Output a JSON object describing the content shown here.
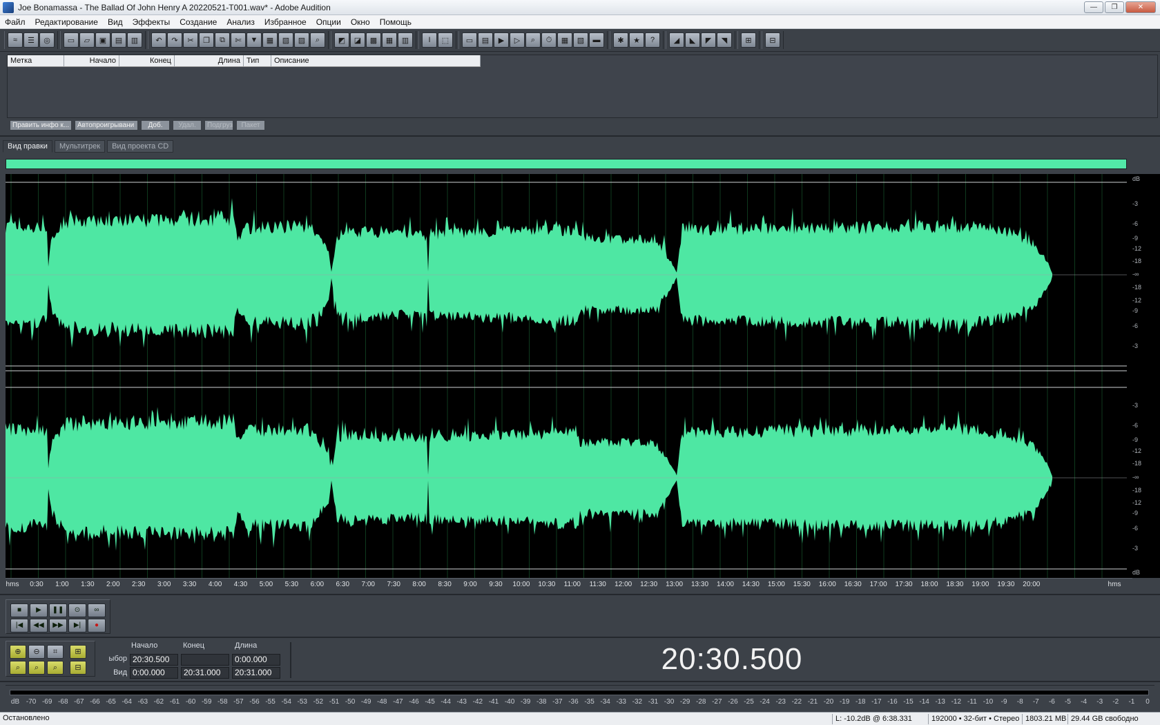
{
  "window": {
    "title": "Joe Bonamassa - The Ballad Of John Henry  A 20220521-T001.wav* - Adobe Audition",
    "buttons": [
      "—",
      "❐",
      "✕"
    ]
  },
  "menu": [
    "Файл",
    "Редактирование",
    "Вид",
    "Эффекты",
    "Создание",
    "Анализ",
    "Избранное",
    "Опции",
    "Окно",
    "Помощь"
  ],
  "cue_list": {
    "columns": [
      "Метка",
      "Начало",
      "Конец",
      "Длина",
      "Тип",
      "Описание"
    ],
    "buttons": [
      {
        "label": "Править инфо к...",
        "enabled": true
      },
      {
        "label": "Автопроигрывани",
        "enabled": true
      },
      {
        "label": "Доб.",
        "enabled": true
      },
      {
        "label": "Удал.",
        "enabled": false
      },
      {
        "label": "Подгруз.",
        "enabled": false
      },
      {
        "label": "Пакет",
        "enabled": false
      }
    ]
  },
  "tabs": [
    {
      "label": "Вид правки",
      "active": true
    },
    {
      "label": "Мультитрек",
      "active": false
    },
    {
      "label": "Вид проекта CD",
      "active": false
    }
  ],
  "waveform": {
    "color": "#4ee7a3",
    "background": "#000000",
    "channels": 2,
    "duration_label": "20:31.000"
  },
  "db_scale": {
    "unit": "dB",
    "top_channel": [
      "dB",
      "-3",
      "-6",
      "-9",
      "-12",
      "-18",
      "-∞",
      "-18",
      "-12",
      "-9",
      "-6",
      "-3"
    ],
    "bottom_channel": [
      "-3",
      "-6",
      "-9",
      "-12",
      "-18",
      "-∞",
      "-18",
      "-12",
      "-9",
      "-6",
      "-3",
      "dB"
    ]
  },
  "timeline": {
    "unit_left": "hms",
    "unit_right": "hms",
    "ticks": [
      "0:30",
      "1:00",
      "1:30",
      "2:00",
      "2:30",
      "3:00",
      "3:30",
      "4:00",
      "4:30",
      "5:00",
      "5:30",
      "6:00",
      "6:30",
      "7:00",
      "7:30",
      "8:00",
      "8:30",
      "9:00",
      "9:30",
      "10:00",
      "10:30",
      "11:00",
      "11:30",
      "12:00",
      "12:30",
      "13:00",
      "13:30",
      "14:00",
      "14:30",
      "15:00",
      "15:30",
      "16:00",
      "16:30",
      "17:00",
      "17:30",
      "18:00",
      "18:30",
      "19:00",
      "19:30",
      "20:00"
    ]
  },
  "transport": {
    "row1": [
      "stop-icon",
      "play-icon",
      "pause-icon",
      "play-to-end-icon",
      "loop-icon"
    ],
    "row2": [
      "go-to-start-icon",
      "rewind-icon",
      "fast-forward-icon",
      "go-to-end-icon",
      "record-icon"
    ]
  },
  "selection": {
    "headers": [
      "Начало",
      "Конец",
      "Длина"
    ],
    "rows": [
      {
        "label": "ыбор",
        "start": "20:30.500",
        "end": "",
        "length": "0:00.000"
      },
      {
        "label": "Вид",
        "start": "0:00.000",
        "end": "20:31.000",
        "length": "20:31.000"
      }
    ]
  },
  "current_time": "20:30.500",
  "level_meter": {
    "ticks": [
      "dB",
      "-70",
      "-69",
      "-68",
      "-67",
      "-66",
      "-65",
      "-64",
      "-63",
      "-62",
      "-61",
      "-60",
      "-59",
      "-58",
      "-57",
      "-56",
      "-55",
      "-54",
      "-53",
      "-52",
      "-51",
      "-50",
      "-49",
      "-48",
      "-47",
      "-46",
      "-45",
      "-44",
      "-43",
      "-42",
      "-41",
      "-40",
      "-39",
      "-38",
      "-37",
      "-36",
      "-35",
      "-34",
      "-33",
      "-32",
      "-31",
      "-30",
      "-29",
      "-28",
      "-27",
      "-26",
      "-25",
      "-24",
      "-23",
      "-22",
      "-21",
      "-20",
      "-19",
      "-18",
      "-17",
      "-16",
      "-15",
      "-14",
      "-13",
      "-12",
      "-11",
      "-10",
      "-9",
      "-8",
      "-7",
      "-6",
      "-5",
      "-4",
      "-3",
      "-2",
      "-1",
      "0"
    ]
  },
  "status": {
    "state": "Остановлено",
    "level": "L: -10.2dB @   6:38.331",
    "format": "192000 • 32-бит • Стерео",
    "size": "1803.21 MB",
    "free": "29.44 GB свободно"
  }
}
